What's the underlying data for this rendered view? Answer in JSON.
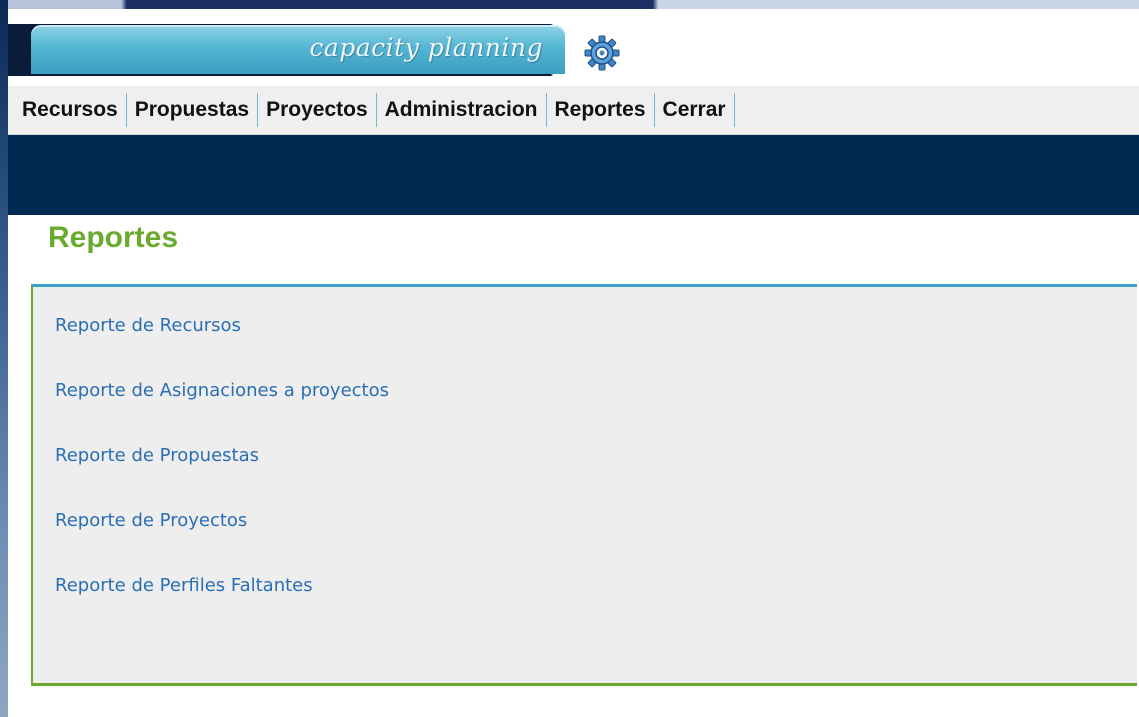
{
  "header": {
    "logo_text": "capacity planning",
    "logo_colors": {
      "tab": "#54b6d4",
      "text": "#f2f6f9"
    },
    "settings_icon": "gear-icon"
  },
  "nav": {
    "items": [
      {
        "label": "Recursos"
      },
      {
        "label": "Propuestas"
      },
      {
        "label": "Proyectos"
      },
      {
        "label": "Administracion"
      },
      {
        "label": "Reportes"
      },
      {
        "label": "Cerrar"
      }
    ]
  },
  "panel": {
    "title": "Reportes",
    "links": [
      {
        "label": "Reporte de Recursos"
      },
      {
        "label": "Reporte de Asignaciones a proyectos"
      },
      {
        "label": "Reporte de Propuestas"
      },
      {
        "label": "Reporte de Proyectos"
      },
      {
        "label": "Reporte de Perfiles Faltantes"
      }
    ]
  },
  "colors": {
    "title_green": "#6aaa2e",
    "link_blue": "#2a6eb5",
    "band_navy": "#002a52",
    "accent_teal": "#3aa0c8"
  }
}
